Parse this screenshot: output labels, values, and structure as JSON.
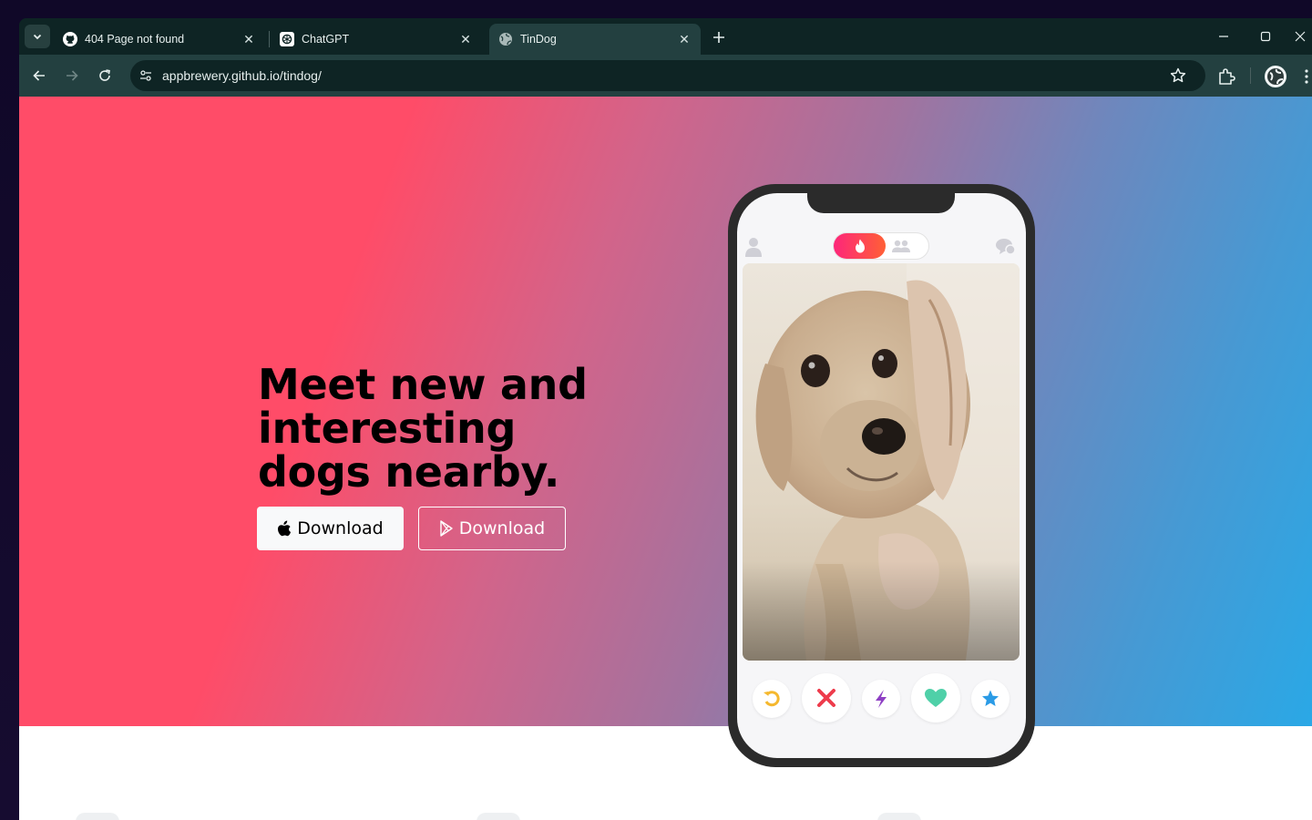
{
  "browser": {
    "tabs": [
      {
        "title": "404 Page not found",
        "icon": "github-icon",
        "active": false
      },
      {
        "title": "ChatGPT",
        "icon": "chatgpt-icon",
        "active": false
      },
      {
        "title": "TinDog",
        "icon": "globe-icon",
        "active": true
      }
    ],
    "url": "appbrewery.github.io/tindog/"
  },
  "hero": {
    "headline": "Meet new and interesting dogs nearby.",
    "buttons": [
      {
        "label": "Download",
        "icon": "apple-icon"
      },
      {
        "label": "Download",
        "icon": "google-play-icon"
      }
    ]
  },
  "phone": {
    "card_image": "dog-photo",
    "actions": [
      "rewind-icon",
      "nope-icon",
      "boost-icon",
      "like-icon",
      "super-like-icon"
    ]
  },
  "colors": {
    "hero_start": "#ff4c68",
    "hero_end": "#2aa8e6",
    "browser_frame": "#0e2424",
    "toolbar": "#234040"
  }
}
